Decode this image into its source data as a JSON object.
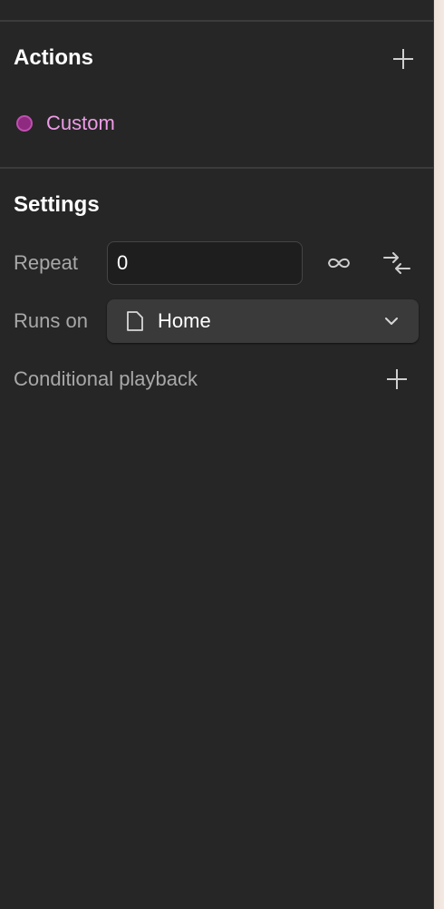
{
  "actions": {
    "title": "Actions",
    "add_icon": "plus-icon",
    "items": [
      {
        "label": "Custom",
        "dot_color": "#8e2a80"
      }
    ]
  },
  "settings": {
    "title": "Settings",
    "repeat": {
      "label": "Repeat",
      "value": "0",
      "infinite_icon": "infinity-icon",
      "collapse_icon": "arrows-inward-icon"
    },
    "runs_on": {
      "label": "Runs on",
      "value": "Home",
      "page_icon": "file-icon",
      "dropdown_icon": "chevron-down-icon"
    },
    "conditional_playback": {
      "label": "Conditional playback",
      "add_icon": "plus-icon"
    }
  },
  "colors": {
    "panel_bg": "#262626",
    "action_accent": "#ee9ce6",
    "text_muted": "#a8a8a8"
  }
}
